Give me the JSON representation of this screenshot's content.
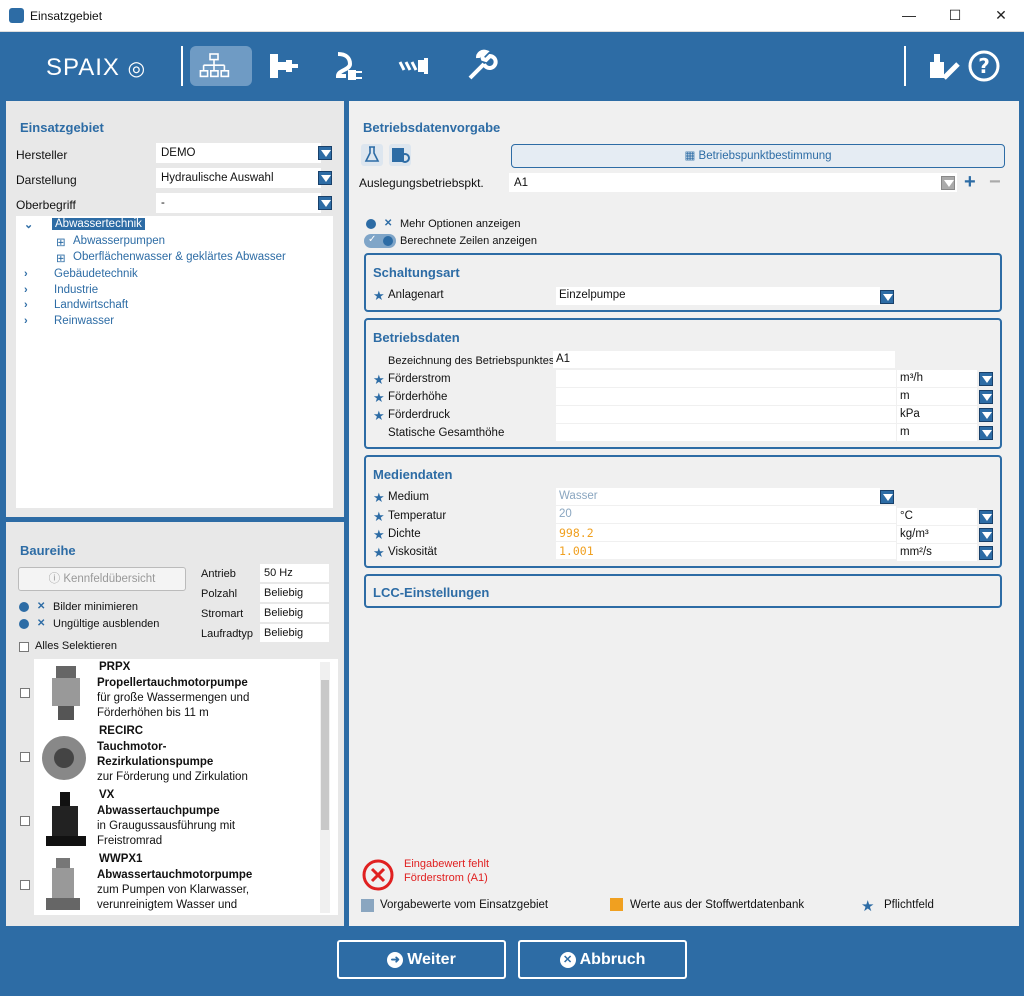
{
  "window": {
    "title": "Einsatzgebiet",
    "min": "—",
    "max": "☐",
    "close": "✕"
  },
  "toolbar": {
    "logo": "SPAIX"
  },
  "einsatzgebiet": {
    "title": "Einsatzgebiet",
    "hersteller_label": "Hersteller",
    "hersteller_value": "DEMO",
    "darstellung_label": "Darstellung",
    "darstellung_value": "Hydraulische Auswahl",
    "oberbegriff_label": "Oberbegriff",
    "oberbegriff_value": "-",
    "tree": [
      "Abwassertechnik",
      "Abwasserpumpen",
      "Oberflächenwasser & geklärtes Abwasser",
      "Gebäudetechnik",
      "Industrie",
      "Landwirtschaft",
      "Reinwasser"
    ]
  },
  "baureihe": {
    "title": "Baureihe",
    "kennfeld_btn": "Kennfeldübersicht",
    "bilder_min": "Bilder minimieren",
    "ungueltige": "Ungültige ausblenden",
    "alles": "Alles Selektieren",
    "antrieb_label": "Antrieb",
    "antrieb_value": "50 Hz",
    "polzahl_label": "Polzahl",
    "polzahl_value": "Beliebig",
    "stromart_label": "Stromart",
    "stromart_value": "Beliebig",
    "laufradtyp_label": "Laufradtyp",
    "laufradtyp_value": "Beliebig",
    "products": [
      {
        "code": "PRPX",
        "name": "Propellertauchmotorpumpe",
        "desc1": "für große Wassermengen und",
        "desc2": "Förderhöhen bis 11 m"
      },
      {
        "code": "RECIRC",
        "name": "Tauchmotor-",
        "name2": "Rezirkulationspumpe",
        "desc1": "zur Förderung und Zirkulation",
        "desc2": ""
      },
      {
        "code": "VX",
        "name": "Abwassertauchpumpe",
        "desc1": "in Graugussausführung mit",
        "desc2": "Freistromrad"
      },
      {
        "code": "WWPX1",
        "name": "Abwassertauchmotorpumpe",
        "desc1": "zum Pumpen von Klarwasser,",
        "desc2": "verunreinigtem Wasser und"
      }
    ]
  },
  "betrieb": {
    "title": "Betriebsdatenvorgabe",
    "bp_btn": "Betriebspunktbestimmung",
    "ausleg_label": "Auslegungsbetriebspkt.",
    "ausleg_value": "A1",
    "mehr": "Mehr Optionen anzeigen",
    "berechnet": "Berechnete Zeilen anzeigen"
  },
  "schaltung": {
    "title": "Schaltungsart",
    "anlagenart_label": "Anlagenart",
    "anlagenart_value": "Einzelpumpe"
  },
  "betriebsdaten": {
    "title": "Betriebsdaten",
    "bez_label": "Bezeichnung des Betriebspunktes",
    "bez_value": "A1",
    "foerderstrom_label": "Förderstrom",
    "foerderstrom_unit": "m³/h",
    "foerderhoehe_label": "Förderhöhe",
    "foerderhoehe_unit": "m",
    "foerderdruck_label": "Förderdruck",
    "foerderdruck_unit": "kPa",
    "statisch_label": "Statische Gesamthöhe",
    "statisch_unit": "m"
  },
  "medien": {
    "title": "Mediendaten",
    "medium_label": "Medium",
    "medium_value": "Wasser",
    "temp_label": "Temperatur",
    "temp_value": "20",
    "temp_unit": "°C",
    "dichte_label": "Dichte",
    "dichte_value": "998.2",
    "dichte_unit": "kg/m³",
    "visk_label": "Viskosität",
    "visk_value": "1.001",
    "visk_unit": "mm²/s"
  },
  "lcc": {
    "title": "LCC-Einstellungen"
  },
  "error": {
    "line1": "Eingabewert fehlt",
    "line2": "Förderstrom (A1)"
  },
  "legend": {
    "vorgabe": "Vorgabewerte vom Einsatzgebiet",
    "stoff": "Werte aus der Stoffwertdatenbank",
    "pflicht": "Pflichtfeld"
  },
  "buttons": {
    "weiter": "Weiter",
    "abbruch": "Abbruch"
  },
  "colors": {
    "accent": "#2d6ca5",
    "orange": "#f0a020",
    "error": "#e02020",
    "vorgabe": "#8aa6c0"
  }
}
